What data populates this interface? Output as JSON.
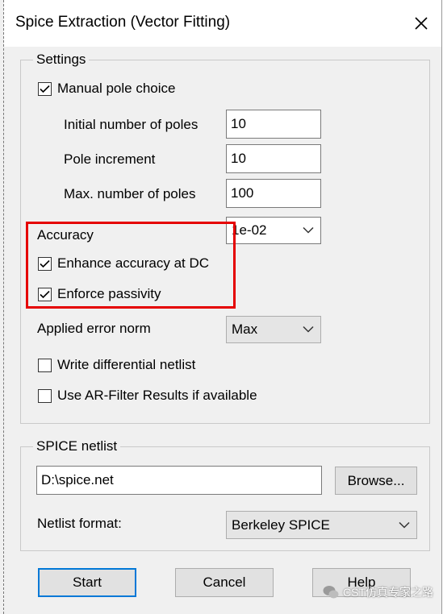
{
  "window": {
    "title": "Spice Extraction (Vector Fitting)"
  },
  "settings": {
    "legend": "Settings",
    "manual_pole_choice": {
      "label": "Manual pole choice",
      "checked": true
    },
    "initial_poles": {
      "label": "Initial number of poles",
      "value": "10"
    },
    "pole_increment": {
      "label": "Pole increment",
      "value": "10"
    },
    "max_poles": {
      "label": "Max. number of poles",
      "value": "100"
    },
    "accuracy": {
      "label": "Accuracy",
      "value": "1e-02"
    },
    "enhance_dc": {
      "label": "Enhance accuracy at DC",
      "checked": true
    },
    "enforce_passivity": {
      "label": "Enforce passivity",
      "checked": true
    },
    "error_norm": {
      "label": "Applied error norm",
      "value": "Max"
    },
    "write_diff_netlist": {
      "label": "Write differential netlist",
      "checked": false
    },
    "use_ar_filter": {
      "label": "Use AR-Filter Results if available",
      "checked": false
    }
  },
  "spice_netlist": {
    "legend": "SPICE netlist",
    "path_value": "D:\\spice.net",
    "browse_label": "Browse...",
    "format_label": "Netlist format:",
    "format_value": "Berkeley SPICE"
  },
  "buttons": {
    "start": "Start",
    "cancel": "Cancel",
    "help": "Help"
  },
  "watermark": {
    "text": "CST仿真专家之路"
  },
  "colors": {
    "highlight": "#e50000",
    "default_button_border": "#0078d7"
  }
}
